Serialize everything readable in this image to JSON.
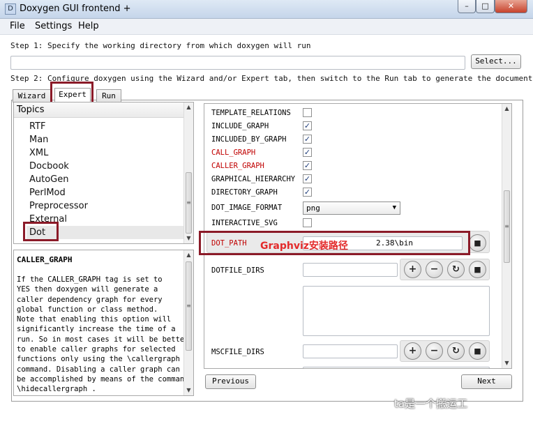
{
  "window": {
    "title": "Doxygen GUI frontend +",
    "icon_glyph": "D",
    "controls": {
      "minimize": "–",
      "maximize": "□",
      "close": "✕"
    }
  },
  "menu": [
    "File",
    "Settings",
    "Help"
  ],
  "step1": {
    "text": "Step 1: Specify the working directory from which doxygen will run",
    "working_dir_value": "",
    "select_label": "Select..."
  },
  "step2": {
    "text": "Step 2: Configure doxygen using the Wizard and/or Expert tab, then switch to the Run tab to generate the documentation"
  },
  "tabs": [
    "Wizard",
    "Expert",
    "Run"
  ],
  "active_tab": "Expert",
  "topics": {
    "header": "Topics",
    "items": [
      "RTF",
      "Man",
      "XML",
      "Docbook",
      "AutoGen",
      "PerlMod",
      "Preprocessor",
      "External",
      "Dot"
    ],
    "selected": "Dot"
  },
  "help": {
    "title": "CALLER_GRAPH",
    "lines": [
      "If the CALLER_GRAPH tag is set to",
      "YES then doxygen will generate a",
      "caller dependency graph for every",
      "global function or class method.",
      "Note that enabling this option will",
      "significantly increase the time of a",
      "run. So in most cases it will be better",
      "to enable caller graphs for selected",
      "functions only using the \\callergraph",
      "command. Disabling a caller graph can",
      "be accomplished by means of the command",
      "\\hidecallergraph ."
    ]
  },
  "options": {
    "template_relations": {
      "label": "TEMPLATE_RELATIONS",
      "checked": false
    },
    "include_graph": {
      "label": "INCLUDE_GRAPH",
      "checked": true
    },
    "included_by_graph": {
      "label": "INCLUDED_BY_GRAPH",
      "checked": true
    },
    "call_graph": {
      "label": "CALL_GRAPH",
      "checked": true
    },
    "caller_graph": {
      "label": "CALLER_GRAPH",
      "checked": true
    },
    "graphical_hierarchy": {
      "label": "GRAPHICAL_HIERARCHY",
      "checked": true
    },
    "directory_graph": {
      "label": "DIRECTORY_GRAPH",
      "checked": true
    },
    "dot_image_format": {
      "label": "DOT_IMAGE_FORMAT",
      "value": "png"
    },
    "interactive_svg": {
      "label": "INTERACTIVE_SVG",
      "checked": false
    },
    "dot_path": {
      "label": "DOT_PATH",
      "value": "D:\\Graphviz2.38\\bin",
      "visible_value": "2.38\\bin"
    },
    "dotfile_dirs": {
      "label": "DOTFILE_DIRS",
      "value": ""
    },
    "mscfile_dirs": {
      "label": "MSCFILE_DIRS",
      "value": ""
    }
  },
  "check_glyph": "✓",
  "annotation": "Graphviz安装路径",
  "nav": {
    "previous": "Previous",
    "next": "Next"
  },
  "watermark": "ta是一个搬运工",
  "colors": {
    "highlight_box": "#8b1a28",
    "required_label": "#c00000",
    "annotation": "#e32b2b"
  }
}
